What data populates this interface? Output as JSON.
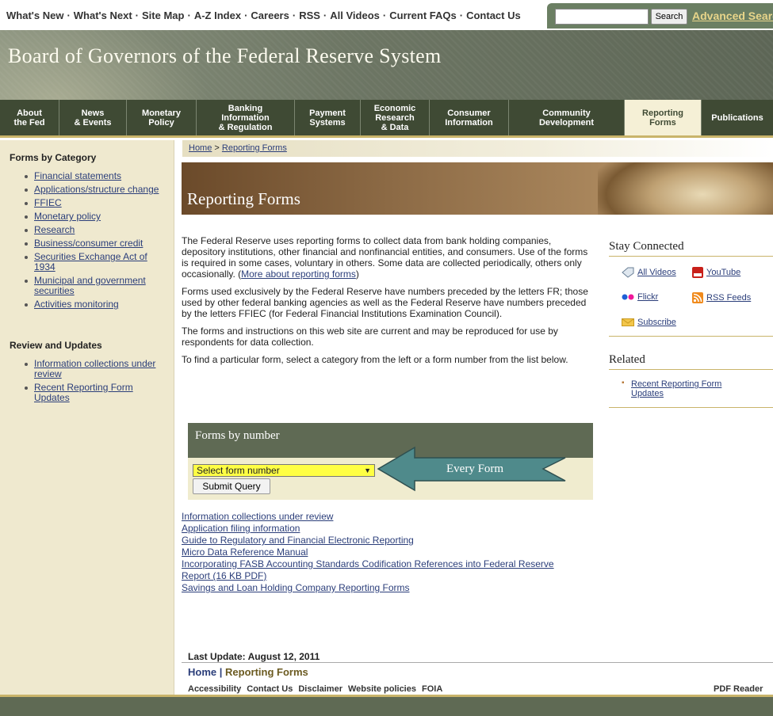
{
  "utility_nav": {
    "items": [
      "What's New",
      "What's Next",
      "Site Map",
      "A-Z Index",
      "Careers",
      "RSS",
      "All Videos",
      "Current FAQs",
      "Contact Us"
    ],
    "separator": "·"
  },
  "search": {
    "placeholder": "",
    "button_label": "Search",
    "advanced_label": "Advanced Search"
  },
  "masthead": {
    "title": "Board of Governors of the Federal Reserve System"
  },
  "main_nav": [
    {
      "label": "About\nthe Fed"
    },
    {
      "label": "News\n& Events"
    },
    {
      "label": "Monetary\nPolicy"
    },
    {
      "label": "Banking\nInformation\n& Regulation"
    },
    {
      "label": "Payment\nSystems"
    },
    {
      "label": "Economic\nResearch\n& Data"
    },
    {
      "label": "Consumer\nInformation"
    },
    {
      "label": "Community\nDevelopment"
    },
    {
      "label": "Reporting\nForms"
    },
    {
      "label": "Publications"
    }
  ],
  "sidebar": {
    "category_heading": "Forms by Category",
    "categories": [
      "Financial statements",
      "Applications/structure change",
      "FFIEC",
      "Monetary policy",
      "Research",
      "Business/consumer credit",
      "Securities Exchange Act of 1934",
      "Municipal and government securities",
      "Activities monitoring"
    ],
    "review_heading": "Review and Updates",
    "review_items": [
      "Information collections under review",
      "Recent Reporting Form Updates"
    ]
  },
  "breadcrumb": {
    "home": "Home",
    "separator": ">",
    "current": "Reporting Forms"
  },
  "banner": {
    "title": "Reporting Forms"
  },
  "intro": {
    "p1_text": "The Federal Reserve uses reporting forms to collect data from bank holding companies, depository institutions, other financial and nonfinancial entities, and consumers. Use of the forms is required in some cases, voluntary in others. Some data are collected periodically, others only occasionally. (",
    "p1_link": "More about reporting forms",
    "p1_end": ")",
    "p2": "Forms used exclusively by the Federal Reserve have numbers preceded by the letters FR; those used by other federal banking agencies as well as the Federal Reserve have numbers preceded by the letters FFIEC (for Federal Financial Institutions Examination Council).",
    "p3": "The forms and instructions on this web site are current and may be reproduced for use by respondents for data collection.",
    "p4": "To find a particular form, select a category from the left or a form number from the list below."
  },
  "forms_by_number": {
    "heading": "Forms by number",
    "select_value": "Select form number",
    "submit_label": "Submit Query",
    "annotation": "Every Form"
  },
  "links": [
    "Information collections under review",
    "Application filing information",
    "Guide to Regulatory and Financial Electronic Reporting",
    "Micro Data Reference Manual",
    "Incorporating FASB Accounting Standards Codification References into Federal Reserve Report (16 KB PDF)",
    "Savings and Loan Holding Company Reporting Forms"
  ],
  "right_column": {
    "stay_connected": "Stay Connected",
    "social": {
      "all_videos": "All Videos",
      "youtube": "YouTube",
      "flickr": "Flickr",
      "rss": "RSS Feeds",
      "subscribe": "Subscribe"
    },
    "related_heading": "Related",
    "related_items": [
      "Recent Reporting Form Updates"
    ]
  },
  "footer": {
    "last_update": "Last Update: August 12, 2011",
    "nav_home": "Home",
    "nav_sep": "|",
    "nav_current": "Reporting Forms",
    "links": [
      "Accessibility",
      "Contact Us",
      "Disclaimer",
      "Website policies",
      "FOIA"
    ],
    "pdf_reader": "PDF Reader"
  },
  "colors": {
    "nav_bg": "#3f4a34",
    "sidebar_bg": "#efe9cf",
    "accent_gold": "#c9b46a",
    "select_highlight": "#ffff44",
    "annotation_arrow": "#4f8a8b",
    "link": "#2b3e7a"
  }
}
